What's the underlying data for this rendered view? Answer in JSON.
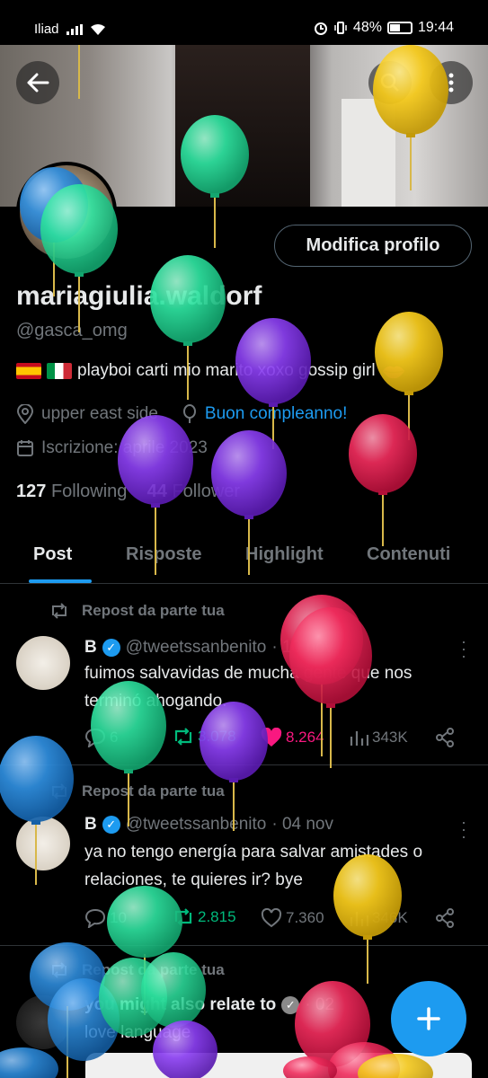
{
  "status_bar": {
    "carrier": "Iliad",
    "battery": "48%",
    "time": "19:44"
  },
  "profile": {
    "edit_button": "Modifica profilo",
    "name": "mariagiulia.waldorf",
    "handle": "@gasca_omg",
    "bio": "playboi carti mio marito xoxo gossip girl",
    "location": "upper east side",
    "birthday_link": "Buon compleanno!",
    "joined": "Iscrizione: aprile 2023",
    "following_count": "127",
    "following_label": "Following",
    "followers_count": "44",
    "followers_label": "Follower"
  },
  "tabs": [
    "Post",
    "Risposte",
    "Highlight",
    "Contenuti"
  ],
  "posts": [
    {
      "repost_label": "Repost da parte tua",
      "name": "B",
      "handle": "@tweetssanbenito",
      "date": "· 10 nov",
      "text": "fuimos salvavidas de mucha gente que nos terminó ahogando.",
      "replies": "6",
      "reposts": "3.078",
      "likes": "8.264",
      "views": "343K"
    },
    {
      "repost_label": "Repost da parte tua",
      "name": "B",
      "handle": "@tweetssanbenito",
      "date": "· 04 nov",
      "text": "ya no tengo energía para salvar amistades o relaciones, te quieres ir? bye",
      "replies": "10",
      "reposts": "2.815",
      "likes": "7.360",
      "views": "346K"
    },
    {
      "repost_label": "Repost da parte tua",
      "name": "you might also relate to",
      "date": "· 02",
      "text": "love language"
    }
  ],
  "colors": {
    "accent": "#1d9bf0",
    "repost_green": "#00ba7c",
    "like_pink": "#f91880",
    "balloon_green": "#2ee3a0",
    "balloon_purple": "#8a3ff0",
    "balloon_yellow": "#f3c81c",
    "balloon_red": "#ef2c5c",
    "balloon_blue": "#2f8fe0"
  }
}
